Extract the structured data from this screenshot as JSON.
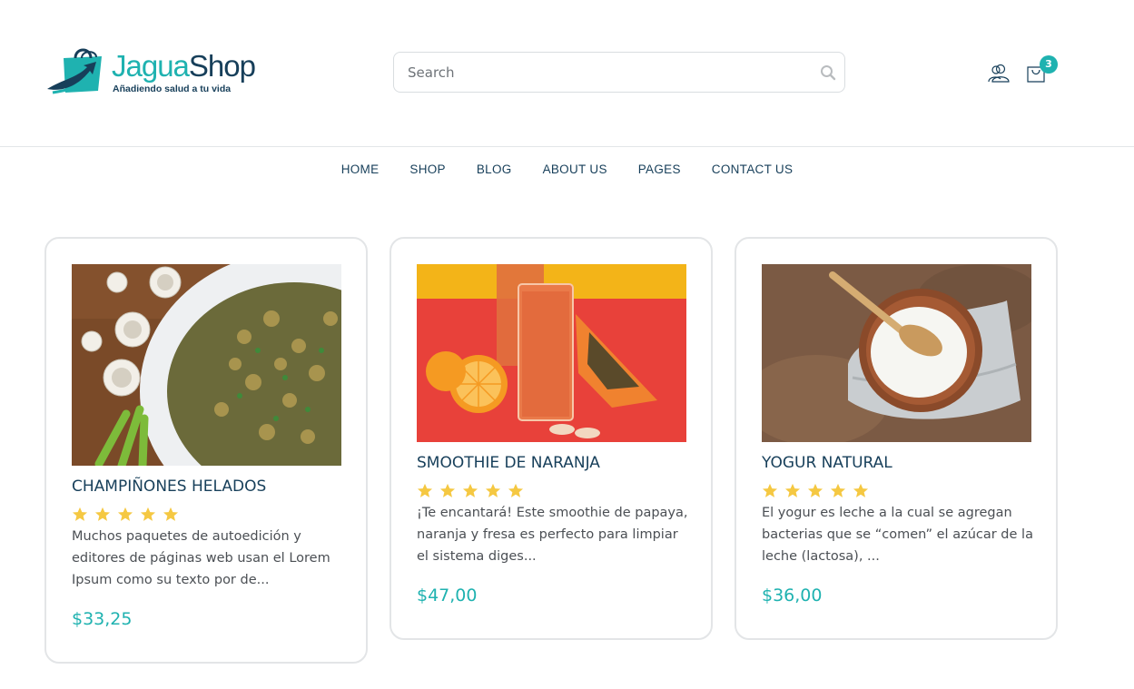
{
  "brand": {
    "name_part1": "Jagua",
    "name_part2": "Shop",
    "tagline": "Añadiendo salud a tu vida"
  },
  "search": {
    "placeholder": "Search"
  },
  "header_icons": {
    "user_icon": "user-icon",
    "cart_icon": "shopping-bag-icon",
    "cart_count": "3"
  },
  "nav": {
    "items": [
      "HOME",
      "SHOP",
      "BLOG",
      "ABOUT US",
      "PAGES",
      "CONTACT US"
    ]
  },
  "colors": {
    "accent": "#1fb2b0",
    "dark": "#173f5a",
    "star": "#f5c842"
  },
  "products": [
    {
      "title": "CHAMPIÑONES HELADOS",
      "rating": 5,
      "description": "Muchos paquetes de autoedición y editores de páginas web usan el Lorem Ipsum como su texto por de...",
      "price": "$33,25"
    },
    {
      "title": "SMOOTHIE DE NARANJA",
      "rating": 5,
      "description": "¡Te encantará! Este smoothie de papaya, naranja y fresa es perfecto para limpiar el sistema diges...",
      "price": "$47,00"
    },
    {
      "title": "YOGUR NATURAL",
      "rating": 5,
      "description": "El yogur es leche a la cual se agregan bacterias que se “comen” el azúcar de la leche (lactosa), ...",
      "price": "$36,00"
    }
  ]
}
